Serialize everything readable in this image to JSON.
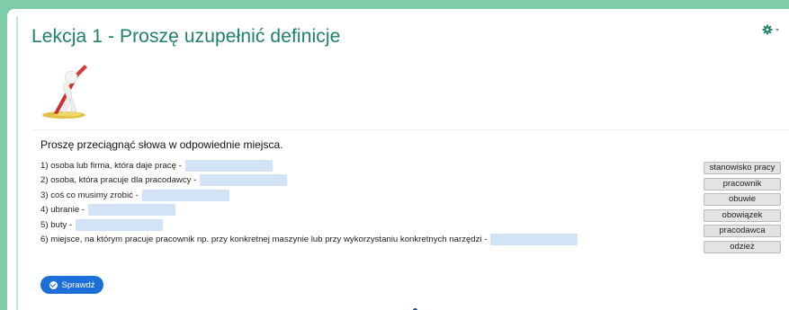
{
  "title": "Lekcja 1 - Proszę uzupełnić definicje",
  "instruction": "Proszę przeciągnąć słowa w odpowiednie miejsca.",
  "sentences": [
    {
      "prefix": "1) osoba lub firma, która daje pracę -"
    },
    {
      "prefix": "2) osoba, która pracuje dla pracodawcy -"
    },
    {
      "prefix": "3) coś co musimy zrobić -"
    },
    {
      "prefix": "4) ubranie -"
    },
    {
      "prefix": "5) buty -"
    },
    {
      "prefix": "6) miejsce, na którym pracuje pracownik np. przy konkretnej maszynie lub przy wykorzystaniu konkretnych narzędzi -"
    }
  ],
  "words": [
    "stanowisko pracy",
    "pracownik",
    "obuwie",
    "obowiązek",
    "pracodawca",
    "odzież"
  ],
  "check_button": {
    "label": "Sprawdź",
    "icon": "check-circle-icon"
  },
  "settings": {
    "icon": "gear-icon"
  },
  "colors": {
    "frame": "#7fcca9",
    "title": "#20806b",
    "blank": "#d3e3f6",
    "button": "#1c6ed9"
  }
}
